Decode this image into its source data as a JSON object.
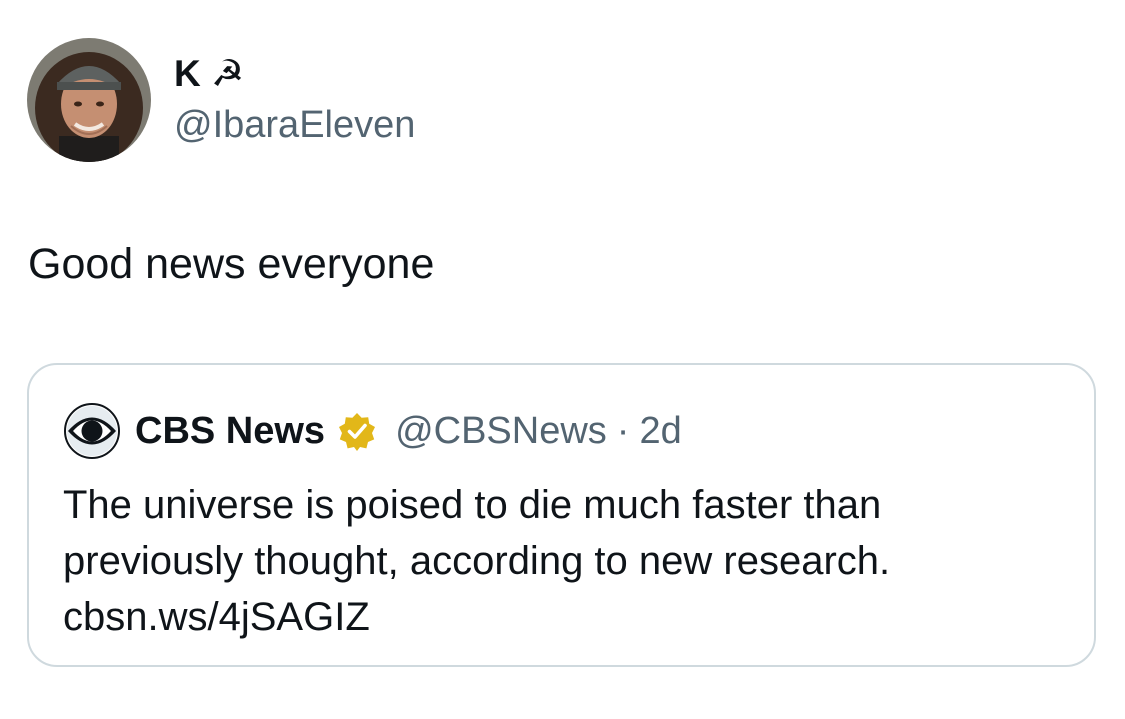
{
  "tweet": {
    "author": {
      "name": "K ☭",
      "handle": "@IbaraEleven",
      "avatar_icon": "profile-photo"
    },
    "text": "Good news everyone",
    "quoted_tweet": {
      "logo_icon": "cbs-eye-logo",
      "name": "CBS News",
      "verified_icon": "verified-badge-gold",
      "verified_color": "#e2b719",
      "handle": "@CBSNews",
      "separator": "·",
      "time": "2d",
      "text_lines": [
        "The universe is poised to die much faster than",
        "previously thought, according to new research.",
        "cbsn.ws/4jSAGIZ"
      ]
    }
  },
  "colors": {
    "text_primary": "#0f1419",
    "text_secondary": "#536471",
    "border": "#cfd9de"
  }
}
